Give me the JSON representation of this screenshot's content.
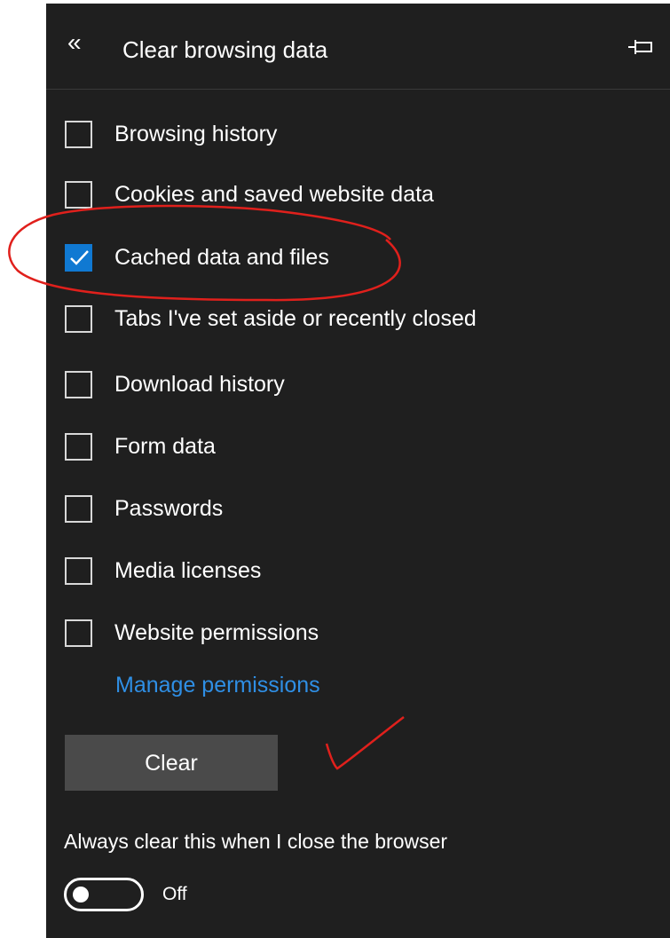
{
  "header": {
    "back_icon": "double-chevron-left-icon",
    "back_glyph": "«",
    "title": "Clear browsing data",
    "pin_icon": "pin-icon"
  },
  "options": [
    {
      "label": "Browsing history",
      "checked": false
    },
    {
      "label": "Cookies and saved website data",
      "checked": false
    },
    {
      "label": "Cached data and files",
      "checked": true
    },
    {
      "label": "Tabs I've set aside or recently closed",
      "checked": false
    },
    {
      "label": "Download history",
      "checked": false
    },
    {
      "label": "Form data",
      "checked": false
    },
    {
      "label": "Passwords",
      "checked": false
    },
    {
      "label": "Media licenses",
      "checked": false
    },
    {
      "label": "Website permissions",
      "checked": false
    }
  ],
  "manage_link": "Manage permissions",
  "clear_button": "Clear",
  "auto_clear": {
    "label": "Always clear this when I close the browser",
    "toggle_state": "Off",
    "enabled": false
  },
  "colors": {
    "panel_bg": "#1f1f1f",
    "accent": "#1079d2",
    "link": "#2f8fe5",
    "button_bg": "#4a4a4a",
    "annotation": "#e0201c"
  }
}
